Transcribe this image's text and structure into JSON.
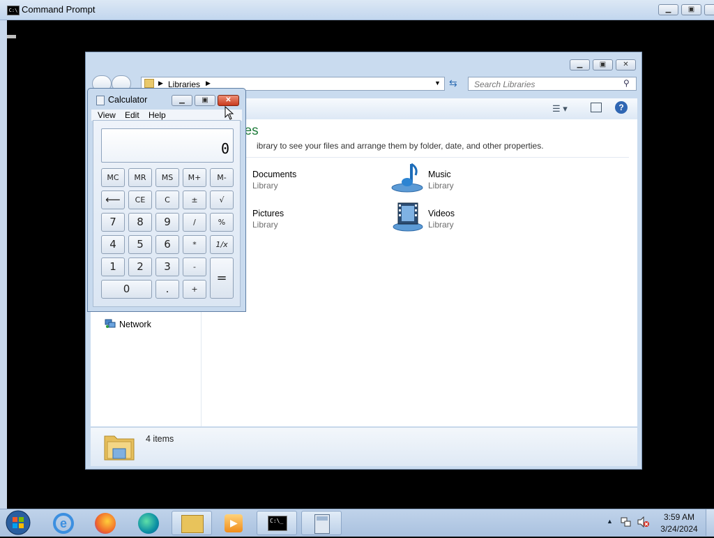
{
  "cmd": {
    "title": "Command Prompt"
  },
  "explorer": {
    "breadcrumb": [
      "Libraries"
    ],
    "search_placeholder": "Search Libraries",
    "heading": "ries",
    "description": "ibrary to see your files and arrange them by folder, date, and other properties.",
    "libraries": [
      {
        "name": "Documents",
        "type": "Library"
      },
      {
        "name": "Music",
        "type": "Library"
      },
      {
        "name": "Pictures",
        "type": "Library"
      },
      {
        "name": "Videos",
        "type": "Library"
      }
    ],
    "nav": {
      "network": "Network"
    },
    "status": {
      "count": "4 items"
    }
  },
  "calculator": {
    "title": "Calculator",
    "menu": [
      "View",
      "Edit",
      "Help"
    ],
    "display": "0",
    "buttons": {
      "mc": "MC",
      "mr": "MR",
      "ms": "MS",
      "mplus": "M+",
      "mminus": "M-",
      "back": "⟵",
      "ce": "CE",
      "c": "C",
      "plusminus": "±",
      "sqrt": "√",
      "seven": "7",
      "eight": "8",
      "nine": "9",
      "divide": "/",
      "percent": "%",
      "four": "4",
      "five": "5",
      "six": "6",
      "multiply": "*",
      "reciprocal": "1/x",
      "one": "1",
      "two": "2",
      "three": "3",
      "minus": "-",
      "equals": "=",
      "zero": "0",
      "decimal": ".",
      "plus": "+"
    }
  },
  "taskbar": {
    "clock_time": "3:59 AM",
    "clock_date": "3/24/2024",
    "apps": [
      "start-orb",
      "internet-explorer",
      "firefox",
      "edge",
      "file-explorer",
      "media-player",
      "command-prompt",
      "calculator"
    ]
  },
  "colors": {
    "heading_green": "#1e7b3a",
    "taskbar": "#b5cbe6",
    "close_red": "#d9472b"
  }
}
